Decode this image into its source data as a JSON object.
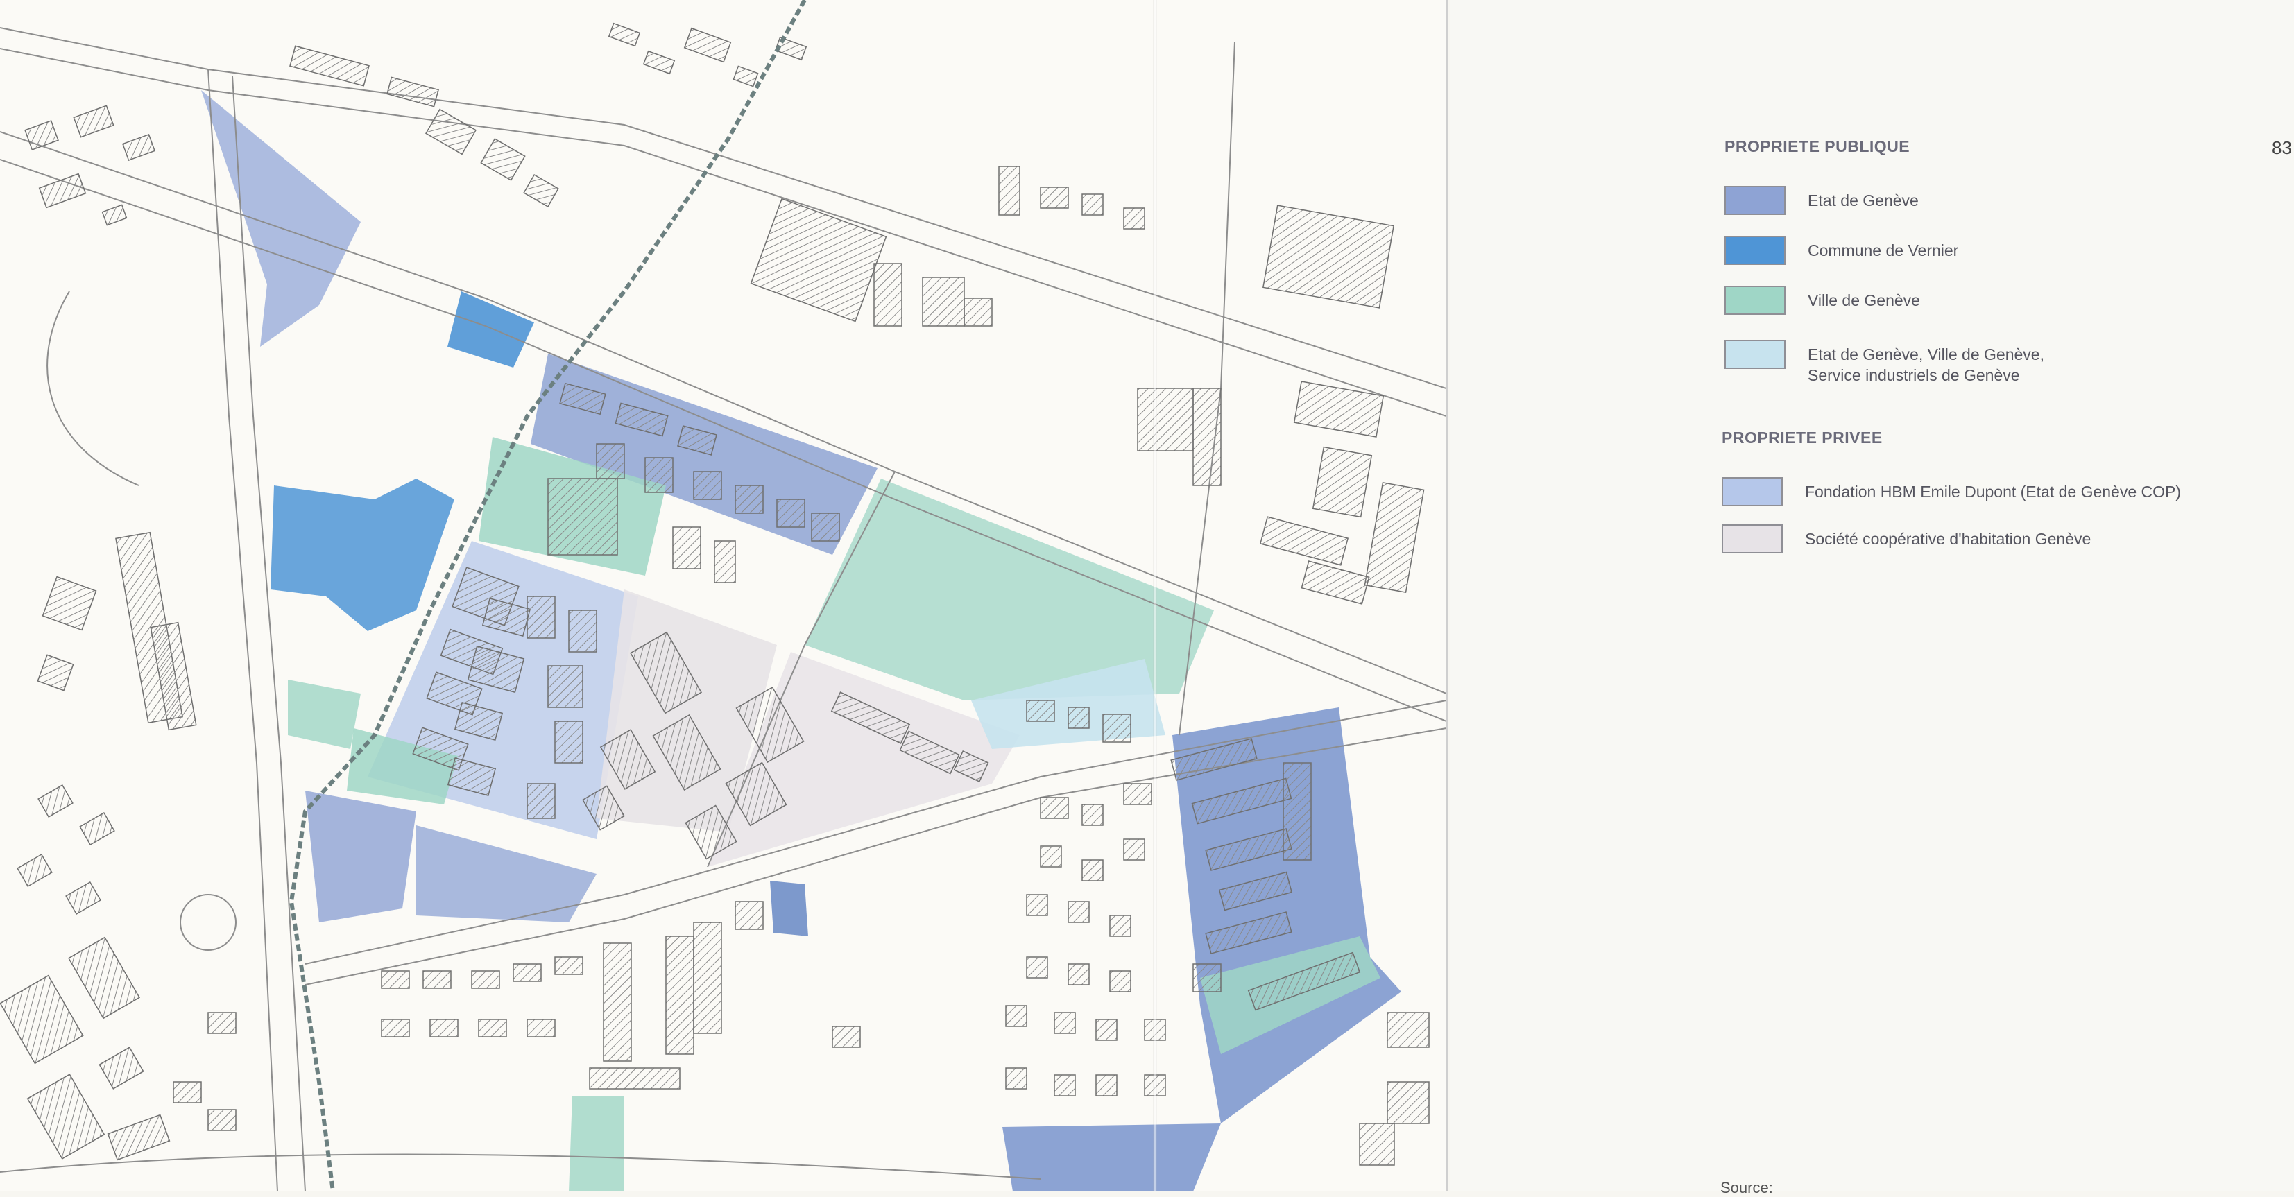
{
  "map": {
    "colors": {
      "etat_de_geneve": "#8ea3d4",
      "commune_de_vernier": "#4f95d6",
      "ville_de_geneve": "#9fd6c6",
      "mixed_public": "#c7e3ee",
      "fondation_hbm": "#b5c7ea",
      "societe_cooperative": "#e7e3e7",
      "building_hatch": "#8c8c8c",
      "railway": "#6c8080"
    }
  },
  "legend": {
    "public_heading": "PROPRIETE PUBLIQUE",
    "public_items": [
      {
        "label": "Etat de Genève",
        "color": "#8ea3d4"
      },
      {
        "label": "Commune de Vernier",
        "color": "#4f95d6"
      },
      {
        "label": "Ville de Genève",
        "color": "#9fd6c6"
      },
      {
        "label": "Etat de Genève, Ville de Genève,\nService industriels de Genève",
        "color": "#c7e3ee"
      }
    ],
    "private_heading": "PROPRIETE PRIVEE",
    "private_items": [
      {
        "label": "Fondation HBM Emile Dupont (Etat de Genève COP)",
        "color": "#b5c7ea"
      },
      {
        "label": "Société coopérative d'habitation Genève",
        "color": "#e7e3e7"
      }
    ],
    "page_number": "83",
    "source_label": "Source:"
  }
}
